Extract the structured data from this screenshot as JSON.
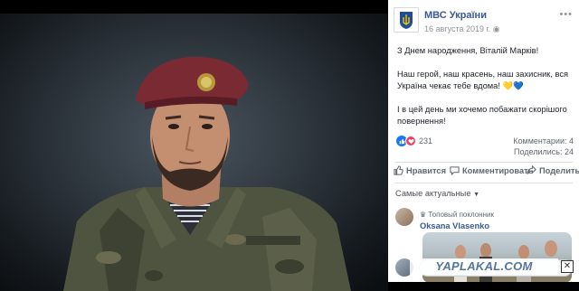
{
  "post": {
    "page_name": "МВС України",
    "date": "16 августа 2019 г.",
    "more_label": "•••",
    "paragraphs": [
      "З Днем народження, Віталій Марків!",
      "Наш герой, наш красень, наш захисник, вся Україна чекає тебе вдома! 💛💙",
      "І в цей день ми хочемо побажати скорішого повернення!"
    ],
    "reactions_count": "231",
    "comments_count": "Комментарии: 4",
    "shares_count": "Поделились: 24"
  },
  "actions": {
    "like": "Нравится",
    "comment": "Комментировать",
    "share": "Поделиться"
  },
  "comments": {
    "sort_label": "Самые актуальные",
    "top_badge": "Топовый поклонник",
    "author": "Oksana Vlasenko"
  },
  "watermark": {
    "text": "YAPLAKAL.COM",
    "close": "✕"
  },
  "colors": {
    "link": "#385898",
    "like": "#1877f2",
    "love": "#f33e58"
  },
  "icons": [
    "thumbs-up-icon",
    "comment-icon",
    "share-icon",
    "caret-down-icon",
    "crown-icon",
    "coat-of-arms-icon"
  ]
}
